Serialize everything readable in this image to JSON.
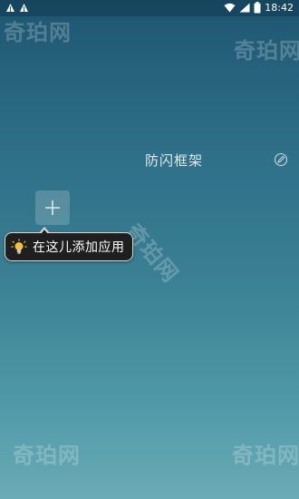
{
  "status_bar": {
    "time": "18:42",
    "left_icons": [
      "notification-icon",
      "notification-icon"
    ],
    "right_icons": [
      "wifi-icon",
      "signal-icon",
      "battery-icon"
    ]
  },
  "watermarks": [
    "奇珀网",
    "奇珀网",
    "奇珀网",
    "奇珀网",
    "奇珀网"
  ],
  "group": {
    "title": "防闪框架",
    "edit_icon": "edit-icon"
  },
  "add_app": {
    "icon": "plus-icon"
  },
  "tooltip": {
    "icon": "lightbulb-icon",
    "text": "在这儿添加应用"
  },
  "colors": {
    "background_top": "#1e5571",
    "background_bottom": "#6aabb6",
    "tooltip_bg": "#1f1f1f",
    "tooltip_border": "#dcdcdc",
    "bulb": "#f4c23a"
  }
}
